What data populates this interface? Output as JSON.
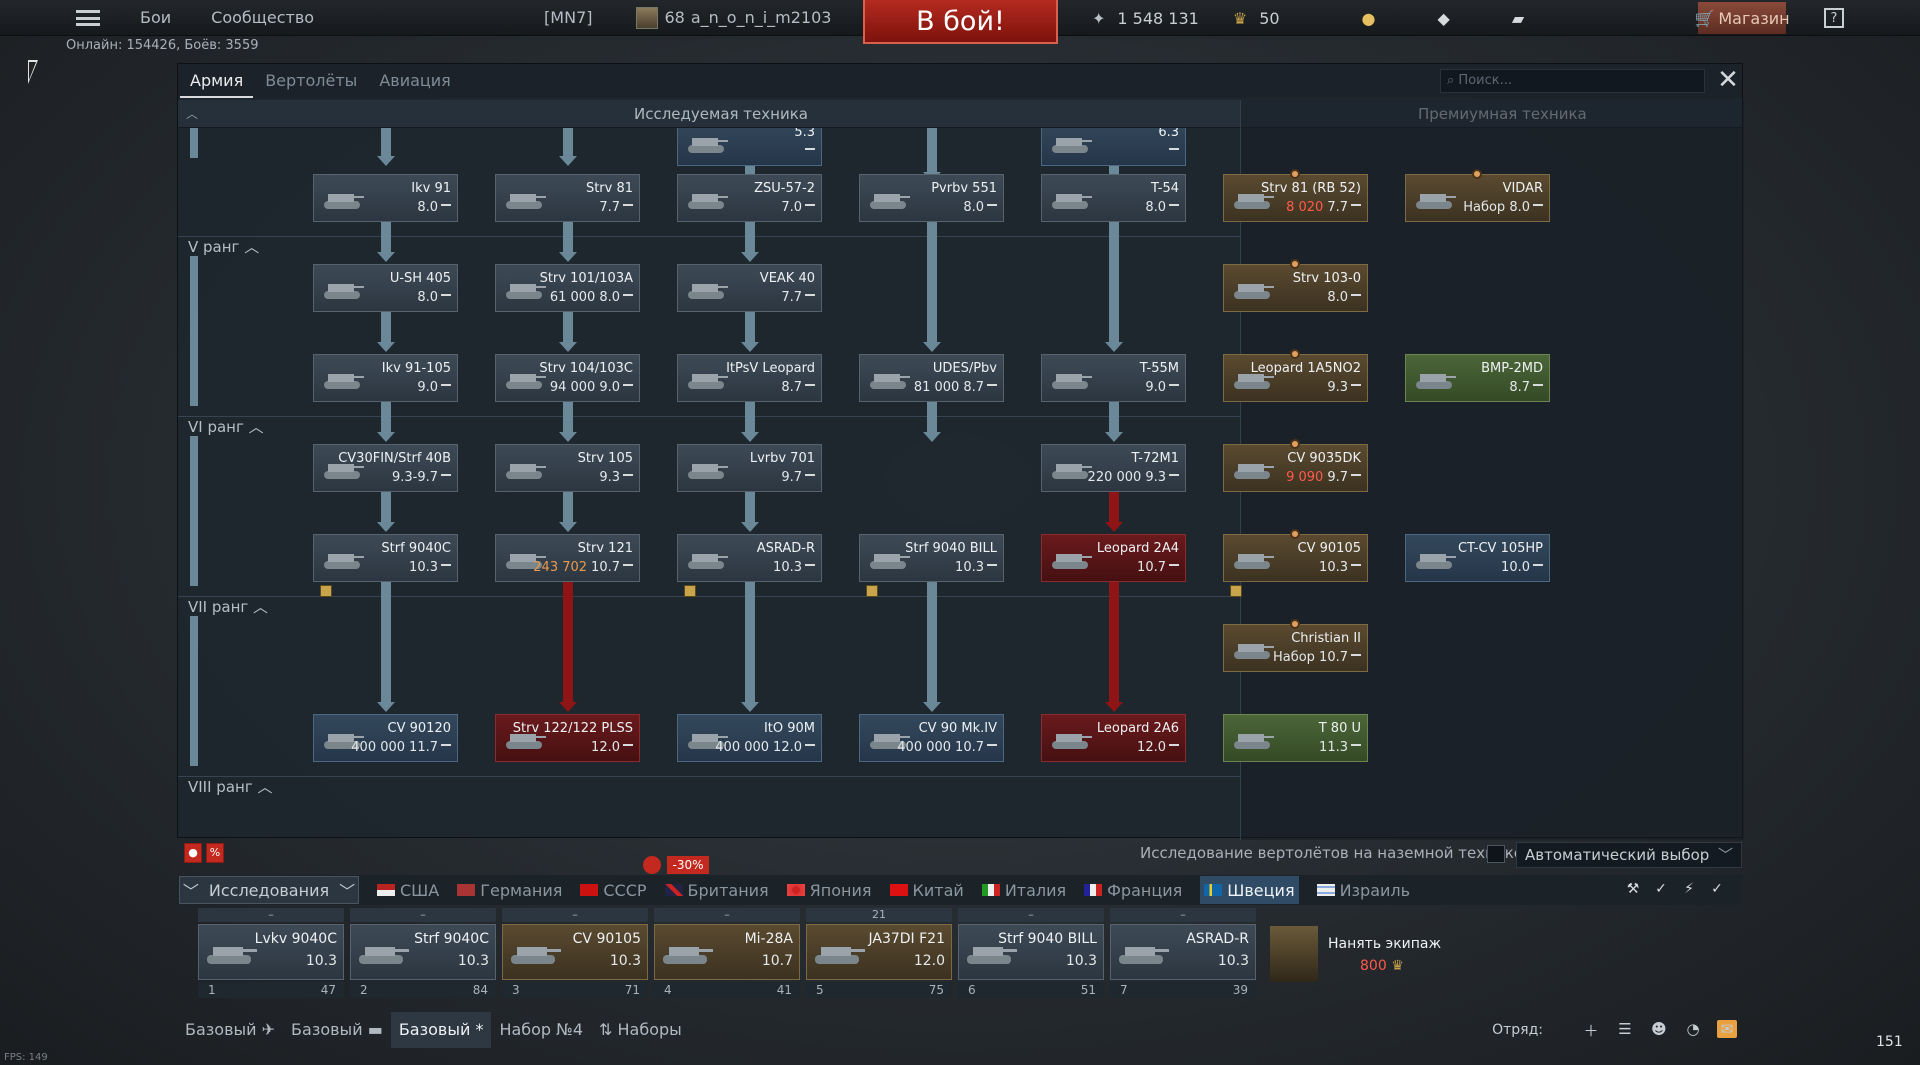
{
  "topbar": {
    "battles": "Бои",
    "community": "Сообщество",
    "squadron": "[MN7]",
    "level": "68",
    "nickname": "a_n_o_n_i_m2103",
    "battle_button": "В бой!",
    "silver_lions": "1 548 131",
    "golden_eagles": "50",
    "shop": "Магазин",
    "help": "?"
  },
  "online_info": "Онлайн: 154426, Боёв: 3559",
  "window": {
    "tabs": [
      "Армия",
      "Вертолёты",
      "Авиация"
    ],
    "search_placeholder": "Поиск...",
    "researchable_title": "Исследуемая техника",
    "premium_title": "Премиумная техника",
    "ranks": [
      "V ранг",
      "VI ранг",
      "VII ранг",
      "VIII ранг"
    ]
  },
  "vehicles": [
    {
      "name": "5.3",
      "br": ""
    },
    {
      "name": "6.3",
      "br": ""
    },
    {
      "name": "Ikv 91",
      "br": "8.0"
    },
    {
      "name": "Strv 81",
      "br": "7.7"
    },
    {
      "name": "ZSU-57-2",
      "br": "7.0"
    },
    {
      "name": "Pvrbv 551",
      "br": "8.0"
    },
    {
      "name": "T-54",
      "br": "8.0"
    },
    {
      "name": "Strv 81 (RB 52)",
      "cost": "8 020",
      "br": "7.7"
    },
    {
      "name": "VIDAR",
      "br": "Набор 8.0"
    },
    {
      "name": "U-SH 405",
      "br": "8.0"
    },
    {
      "name": "Strv 101/103A",
      "cost": "61 000",
      "br": "8.0"
    },
    {
      "name": "VEAK 40",
      "br": "7.7"
    },
    {
      "name": "Strv 103-0",
      "br": "8.0"
    },
    {
      "name": "Ikv 91-105",
      "br": "9.0"
    },
    {
      "name": "Strv 104/103C",
      "cost": "94 000",
      "br": "9.0"
    },
    {
      "name": "ItPsV Leopard",
      "br": "8.7"
    },
    {
      "name": "UDES/Pbv",
      "cost": "81 000",
      "br": "8.7"
    },
    {
      "name": "T-55M",
      "br": "9.0"
    },
    {
      "name": "Leopard 1A5NO2",
      "br": "9.3"
    },
    {
      "name": "BMP-2MD",
      "br": "8.7"
    },
    {
      "name": "CV30FIN/Strf 40B",
      "br": "9.3-9.7"
    },
    {
      "name": "Strv 105",
      "br": "9.3"
    },
    {
      "name": "Lvrbv 701",
      "br": "9.7"
    },
    {
      "name": "T-72M1",
      "cost": "220 000",
      "br": "9.3"
    },
    {
      "name": "CV 9035DK",
      "cost": "9 090",
      "br": "9.7"
    },
    {
      "name": "Strf 9040C",
      "br": "10.3"
    },
    {
      "name": "Strv 121",
      "cost": "243 702",
      "br": "10.7"
    },
    {
      "name": "ASRAD-R",
      "br": "10.3"
    },
    {
      "name": "Strf 9040 BILL",
      "br": "10.3"
    },
    {
      "name": "Leopard 2A4",
      "br": "10.7"
    },
    {
      "name": "CV 90105",
      "br": "10.3"
    },
    {
      "name": "CT-CV 105HP",
      "br": "10.0"
    },
    {
      "name": "Christian II",
      "br": "Набор 10.7"
    },
    {
      "name": "CV 90120",
      "cost": "400 000",
      "br": "11.7"
    },
    {
      "name": "Strv 122/122 PLSS",
      "br": "12.0"
    },
    {
      "name": "ItO 90M",
      "cost": "400 000",
      "br": "12.0"
    },
    {
      "name": "CV 90 Mk.IV",
      "cost": "400 000",
      "br": "10.7"
    },
    {
      "name": "Leopard 2A6",
      "br": "12.0"
    },
    {
      "name": "T 80 U",
      "br": "11.3"
    }
  ],
  "bottom": {
    "heli_research": "Исследование вертолётов на наземной технике",
    "auto_select": "Автоматический выбор",
    "discount": "-30%",
    "research_button": "Исследования",
    "nations": [
      "США",
      "Германия",
      "СССР",
      "Британия",
      "Япония",
      "Китай",
      "Италия",
      "Франция",
      "Швеция",
      "Израиль"
    ],
    "active_nation": "Швеция"
  },
  "crew_slots": [
    {
      "top": "–",
      "name": "Lvkv 9040C",
      "br": "10.3",
      "num": "1",
      "crew": "47"
    },
    {
      "top": "–",
      "name": "Strf 9040C",
      "br": "10.3",
      "num": "2",
      "crew": "84"
    },
    {
      "top": "–",
      "name": "CV 90105",
      "br": "10.3",
      "num": "3",
      "crew": "71"
    },
    {
      "top": "–",
      "name": "Mi-28A",
      "br": "10.7",
      "num": "4",
      "crew": "41"
    },
    {
      "top": "21",
      "name": "JA37DI F21",
      "br": "12.0",
      "num": "5",
      "crew": "75"
    },
    {
      "top": "–",
      "name": "Strf 9040 BILL",
      "br": "10.3",
      "num": "6",
      "crew": "51"
    },
    {
      "top": "–",
      "name": "ASRAD-R",
      "br": "10.3",
      "num": "7",
      "crew": "39"
    }
  ],
  "hire_crew": {
    "label": "Нанять экипаж",
    "cost": "800"
  },
  "presets": [
    "Базовый",
    "Базовый",
    "Базовый *",
    "Набор №4",
    "Наборы"
  ],
  "squad_label": "Отряд:",
  "corner_number": "151",
  "fps": "FPS: 149"
}
